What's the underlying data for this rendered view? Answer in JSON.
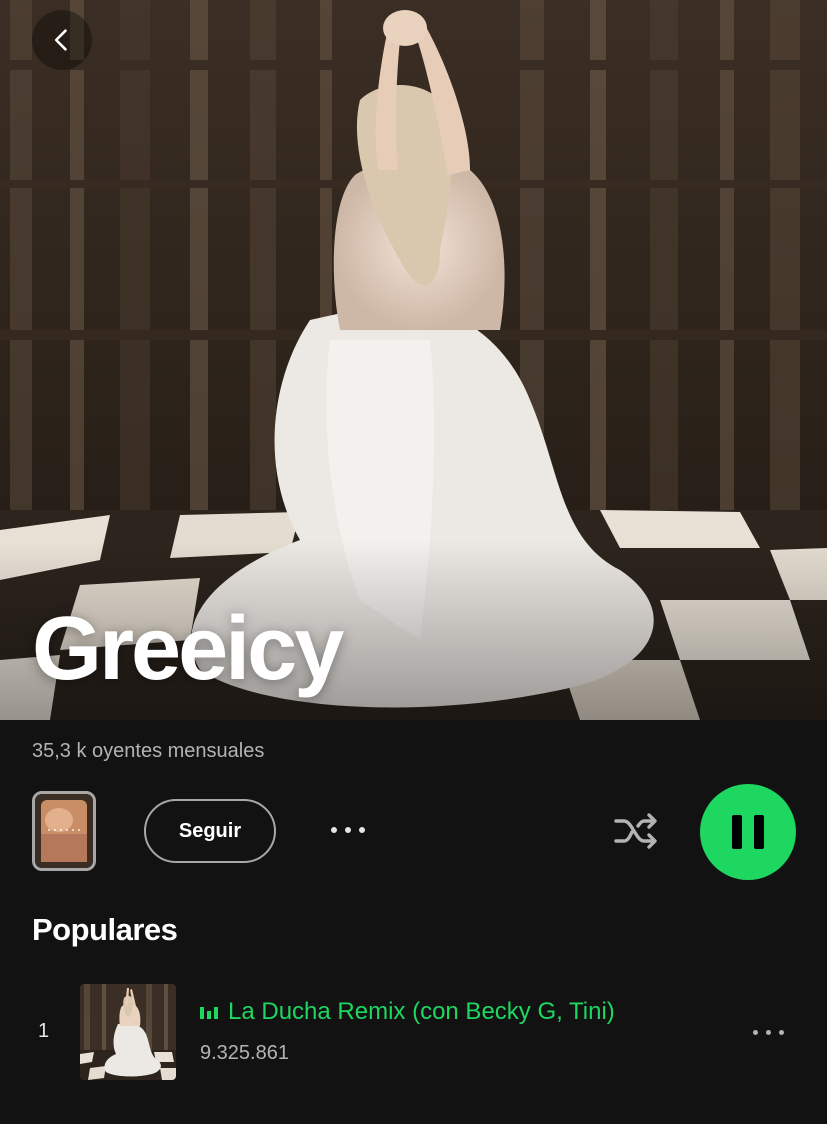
{
  "artist": {
    "name": "Greeicy",
    "monthly_listeners": "35,3 k oyentes mensuales"
  },
  "controls": {
    "follow_label": "Seguir"
  },
  "popular": {
    "section_title": "Populares",
    "tracks": [
      {
        "number": "1",
        "title": "La Ducha Remix (con Becky G, Tini)",
        "plays": "9.325.861",
        "now_playing": true
      }
    ]
  },
  "icons": {
    "back": "chevron-left-icon",
    "more": "more-horizontal-icon",
    "shuffle": "shuffle-icon",
    "pause": "pause-icon",
    "equalizer": "equalizer-icon"
  },
  "colors": {
    "background": "#121212",
    "accent": "#1ed760",
    "secondary_text": "#b3b3b3"
  }
}
